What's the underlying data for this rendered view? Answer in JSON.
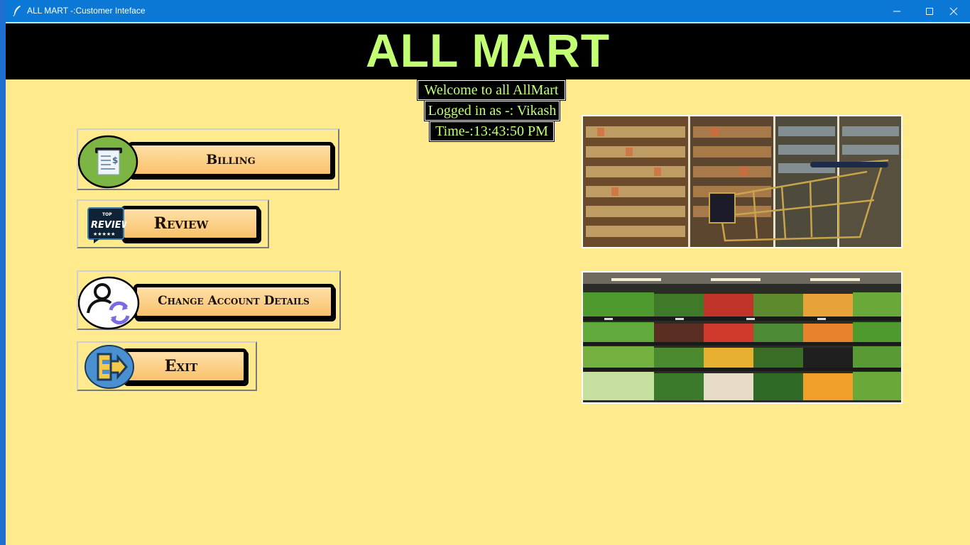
{
  "window": {
    "title": "ALL MART -:Customer Inteface",
    "controls": [
      "minimize",
      "maximize",
      "close"
    ]
  },
  "header": {
    "title": "ALL MART"
  },
  "info": {
    "welcome": "Welcome to all AllMart",
    "logged_in": "Logged in as -: Vikash",
    "time": "Time-:13:43:50 PM"
  },
  "menu": {
    "billing": {
      "label": "Billing",
      "icon": "receipt-icon"
    },
    "review": {
      "label": "Review",
      "icon": "top-review-badge-icon"
    },
    "change_account": {
      "label": "Change Account Details",
      "icon": "user-sync-icon"
    },
    "exit": {
      "label": "Exit",
      "icon": "exit-door-icon"
    }
  },
  "images": {
    "top": "supermarket-shopping-cart-photo",
    "bottom": "vegetable-shelves-photo"
  },
  "colors": {
    "background": "#ffeb8d",
    "banner": "#000000",
    "accent_text": "#c3ff73",
    "titlebar": "#0a78d4"
  }
}
